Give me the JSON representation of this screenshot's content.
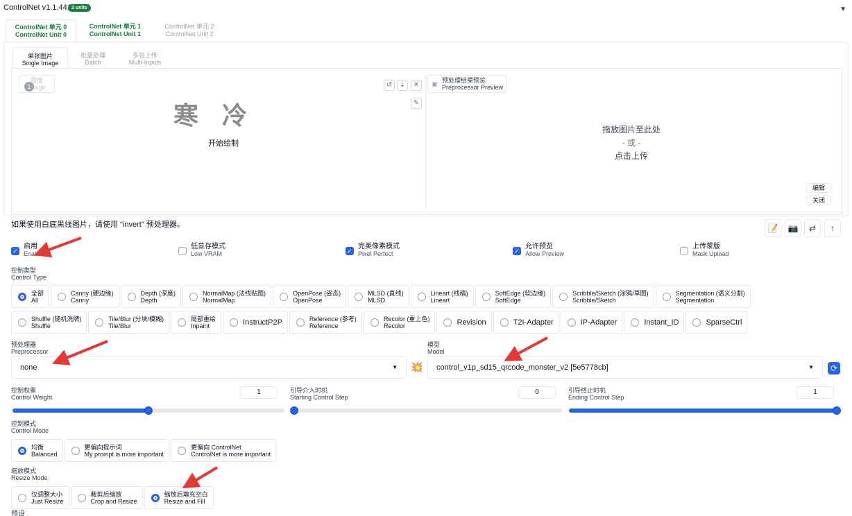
{
  "header": {
    "title": "ControlNet v1.1.441",
    "units_badge": "2 units",
    "collapse_icon": "▼"
  },
  "unit_tabs": [
    {
      "cn": "ControlNet 单元 0",
      "en": "ControlNet Unit 0"
    },
    {
      "cn": "ControlNet 单元 1",
      "en": "ControlNet Unit 1"
    },
    {
      "cn": "ControlNet 单元 2",
      "en": "ControlNet Unit 2"
    }
  ],
  "image_tabs": [
    {
      "cn": "单张图片",
      "en": "Single Image"
    },
    {
      "cn": "批量处理",
      "en": "Batch"
    },
    {
      "cn": "多张上传",
      "en": "Multi-Inputs"
    }
  ],
  "canvas": {
    "image_label_cn": "图像",
    "image_label_en": "Image",
    "badge": "1",
    "big_text": "寒冷",
    "start_draw": "开始绘制",
    "tool_icons": [
      "↺",
      "⇣",
      "✕",
      "✎"
    ]
  },
  "preview": {
    "button_cn": "预处理结果预览",
    "button_en": "Preprocessor Preview",
    "drop_line1": "拖放图片至此处",
    "drop_or": "- 或 -",
    "drop_line2": "点击上传",
    "edit_label": "编辑",
    "close_label": "关闭"
  },
  "invert_hint": "如果使用白底黑线图片，请使用 \"invert\" 预处理器。",
  "toolbar_icons": [
    "📝",
    "📷",
    "⇄",
    "↑"
  ],
  "checkboxes": [
    {
      "cn": "启用",
      "en": "Enable",
      "checked": true
    },
    {
      "cn": "低显存模式",
      "en": "Low VRAM",
      "checked": false
    },
    {
      "cn": "完美像素模式",
      "en": "Pixel Perfect",
      "checked": true
    },
    {
      "cn": "允许预览",
      "en": "Allow Preview",
      "checked": true
    },
    {
      "cn": "上传蒙版",
      "en": "Mask Upload",
      "checked": false
    }
  ],
  "control_type": {
    "label_cn": "控制类型",
    "label_en": "Control Type",
    "row1": [
      {
        "cn": "全部",
        "en": "All",
        "selected": true
      },
      {
        "cn": "Canny (硬边缘)",
        "en": "Canny"
      },
      {
        "cn": "Depth (深度)",
        "en": "Depth"
      },
      {
        "cn": "NormalMap (法线贴图)",
        "en": "NormalMap"
      },
      {
        "cn": "OpenPose (姿态)",
        "en": "OpenPose"
      },
      {
        "cn": "MLSD (直线)",
        "en": "MLSD"
      },
      {
        "cn": "Lineart (线稿)",
        "en": "Lineart"
      },
      {
        "cn": "SoftEdge (软边缘)",
        "en": "SoftEdge"
      },
      {
        "cn": "Scribble/Sketch (涂鸦/草图)",
        "en": "Scribble/Sketch"
      },
      {
        "cn": "Segmentation (语义分割)",
        "en": "Segmentation"
      }
    ],
    "row2": [
      {
        "cn": "Shuffle (随机洗牌)",
        "en": "Shuffle"
      },
      {
        "cn": "Tile/Blur (分块/模糊)",
        "en": "Tile/Blur"
      },
      {
        "cn": "局部重绘",
        "en": "Inpaint"
      },
      {
        "cn": "InstructP2P",
        "en": ""
      },
      {
        "cn": "Reference (参考)",
        "en": "Reference"
      },
      {
        "cn": "Recolor (重上色)",
        "en": "Recolor"
      },
      {
        "cn": "Revision",
        "en": ""
      },
      {
        "cn": "T2I-Adapter",
        "en": ""
      },
      {
        "cn": "IP-Adapter",
        "en": ""
      },
      {
        "cn": "Instant_ID",
        "en": ""
      },
      {
        "cn": "SparseCtrl",
        "en": ""
      }
    ]
  },
  "preprocessor": {
    "label_cn": "预处理器",
    "label_en": "Preprocessor",
    "value": "none",
    "run_icon": "💥"
  },
  "model": {
    "label_cn": "模型",
    "label_en": "Model",
    "value": "control_v1p_sd15_qrcode_monster_v2 [5e5778cb]",
    "refresh_icon": "⟳"
  },
  "sliders": [
    {
      "cn": "控制权重",
      "en": "Control Weight",
      "value": "1",
      "fraction": 0.5
    },
    {
      "cn": "引导介入时机",
      "en": "Starting Control Step",
      "value": "0",
      "fraction": 0
    },
    {
      "cn": "引导终止时机",
      "en": "Ending Control Step",
      "value": "1",
      "fraction": 1
    }
  ],
  "control_mode": {
    "label_cn": "控制模式",
    "label_en": "Control Mode",
    "options": [
      {
        "cn": "均衡",
        "en": "Balanced",
        "selected": true
      },
      {
        "cn": "更偏向提示词",
        "en": "My prompt is more important"
      },
      {
        "cn": "更偏向 ControlNet",
        "en": "ControlNet is more important"
      }
    ]
  },
  "resize_mode": {
    "label_cn": "缩放模式",
    "label_en": "Resize Mode",
    "options": [
      {
        "cn": "仅调整大小",
        "en": "Just Resize"
      },
      {
        "cn": "裁剪后缩放",
        "en": "Crop and Resize"
      },
      {
        "cn": "缩放后填充空白",
        "en": "Resize and Fill",
        "selected": true
      }
    ]
  },
  "presets_label": "预设",
  "colors": {
    "accent": "#2563eb",
    "tab_green": "#15803d",
    "annotation_arrow": "#e53935"
  }
}
